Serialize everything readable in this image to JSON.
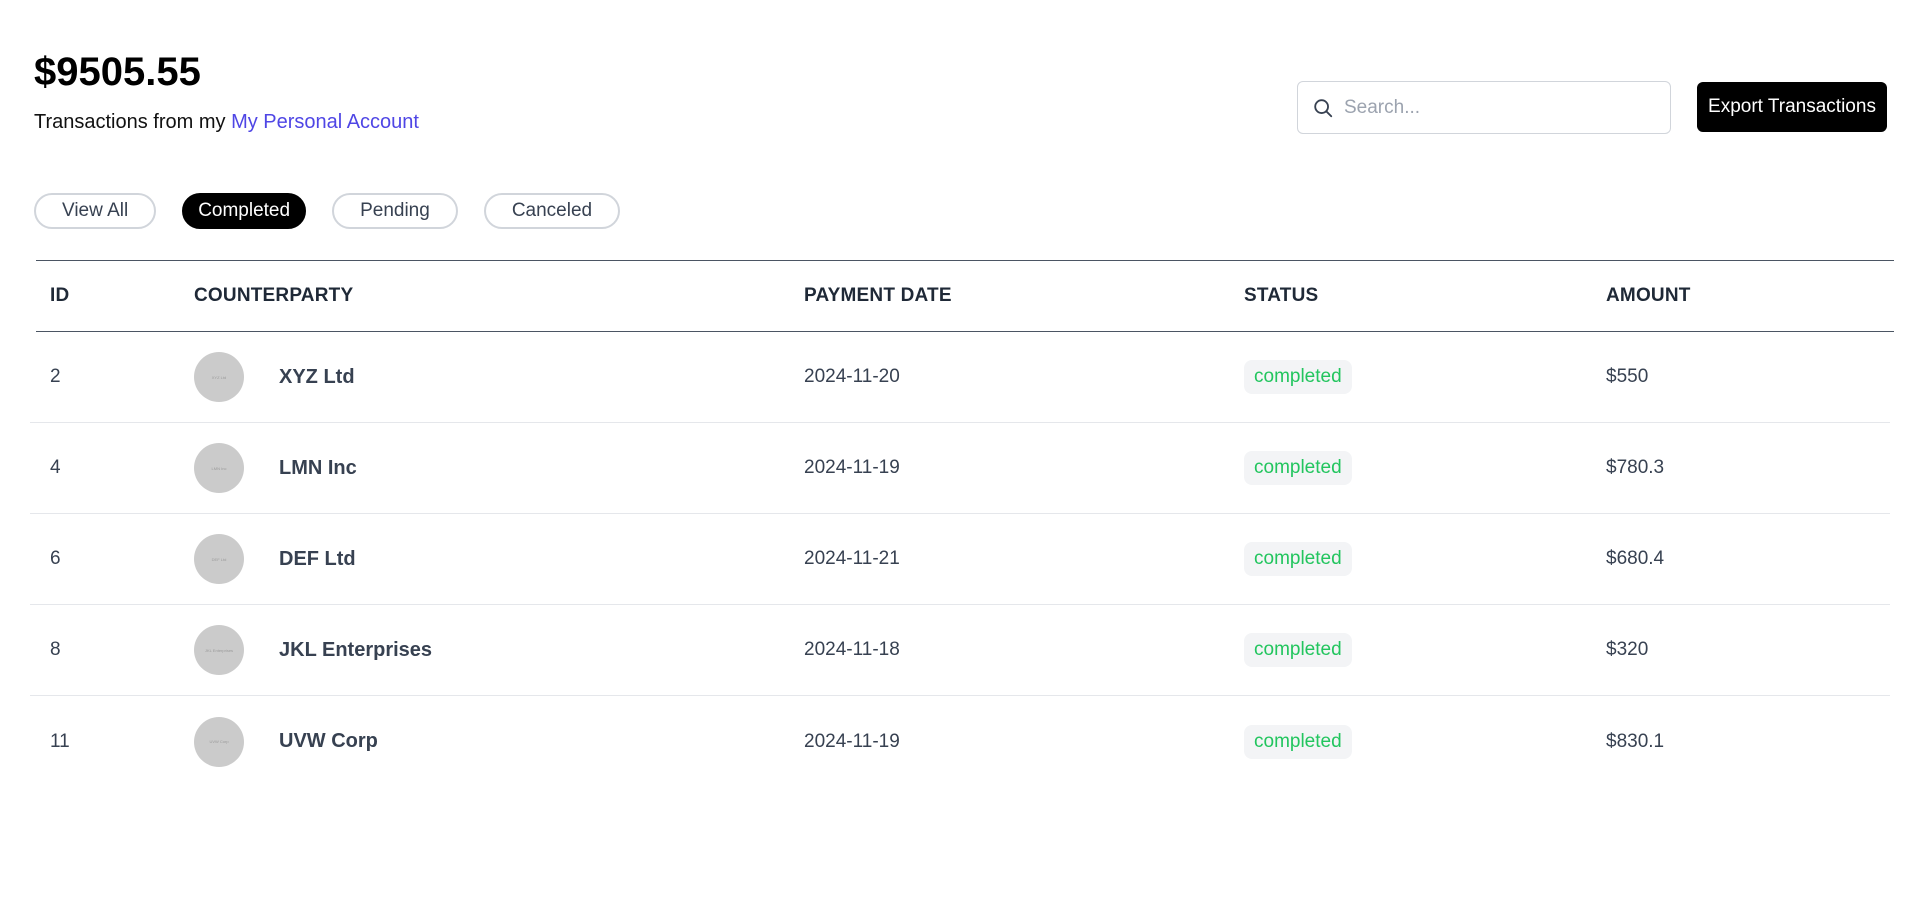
{
  "header": {
    "balance": "$9505.55",
    "subtitle_prefix": "Transactions from my",
    "account_link": "My Personal Account"
  },
  "search": {
    "placeholder": "Search..."
  },
  "actions": {
    "export_label": "Export Transactions"
  },
  "filters": [
    {
      "label": "View All",
      "active": false
    },
    {
      "label": "Completed",
      "active": true
    },
    {
      "label": "Pending",
      "active": false
    },
    {
      "label": "Canceled",
      "active": false
    }
  ],
  "table": {
    "columns": [
      "ID",
      "COUNTERPARTY",
      "PAYMENT DATE",
      "STATUS",
      "AMOUNT"
    ],
    "rows": [
      {
        "id": "2",
        "counterparty": "XYZ Ltd",
        "date": "2024-11-20",
        "status": "completed",
        "amount": "$550"
      },
      {
        "id": "4",
        "counterparty": "LMN Inc",
        "date": "2024-11-19",
        "status": "completed",
        "amount": "$780.3"
      },
      {
        "id": "6",
        "counterparty": "DEF Ltd",
        "date": "2024-11-21",
        "status": "completed",
        "amount": "$680.4"
      },
      {
        "id": "8",
        "counterparty": "JKL Enterprises",
        "date": "2024-11-18",
        "status": "completed",
        "amount": "$320"
      },
      {
        "id": "11",
        "counterparty": "UVW Corp",
        "date": "2024-11-19",
        "status": "completed",
        "amount": "$830.1"
      }
    ]
  },
  "colors": {
    "link": "#4f46e5",
    "status_completed": "#22c55e",
    "primary": "#000000"
  }
}
